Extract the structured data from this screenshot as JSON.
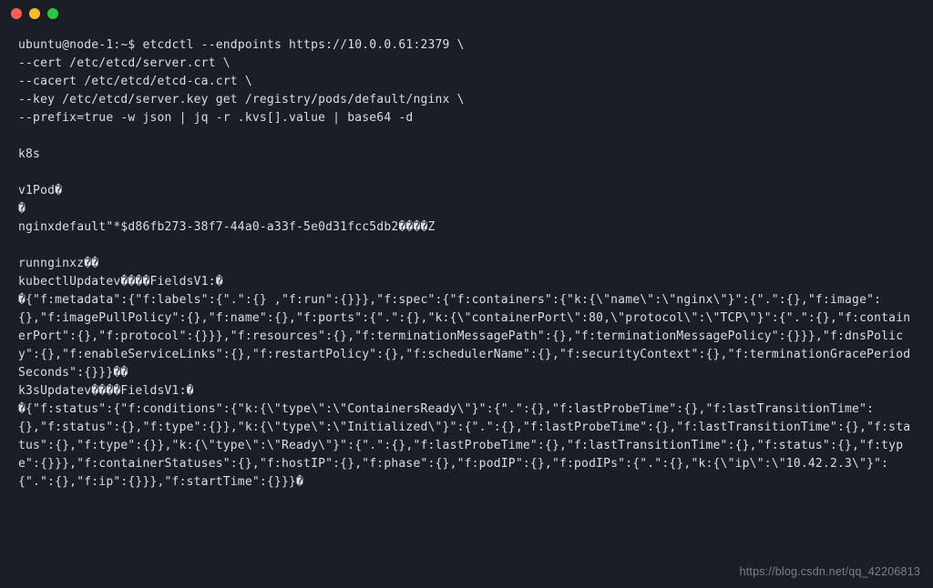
{
  "prompt": "ubuntu@node-1:~$ ",
  "command_lines": [
    "etcdctl --endpoints https://10.0.0.61:2379 \\",
    "--cert /etc/etcd/server.crt \\",
    "--cacert /etc/etcd/etcd-ca.crt \\",
    "--key /etc/etcd/server.key get /registry/pods/default/nginx \\",
    "--prefix=true -w json | jq -r .kvs[].value | base64 -d"
  ],
  "output_lines": [
    "",
    "k8s",
    "",
    "v1Pod�",
    "�",
    "nginxdefault\"*$d86fb273-38f7-44a0-a33f-5e0d31fcc5db2����Z",
    "",
    "runnginxz��",
    "kubectlUpdatev����FieldsV1:�",
    "�{\"f:metadata\":{\"f:labels\":{\".\":{} ,\"f:run\":{}}},\"f:spec\":{\"f:containers\":{\"k:{\\\"name\\\":\\\"nginx\\\"}\":{\".\":{},\"f:image\":{},\"f:imagePullPolicy\":{},\"f:name\":{},\"f:ports\":{\".\":{},\"k:{\\\"containerPort\\\":80,\\\"protocol\\\":\\\"TCP\\\"}\":{\".\":{},\"f:containerPort\":{},\"f:protocol\":{}}},\"f:resources\":{},\"f:terminationMessagePath\":{},\"f:terminationMessagePolicy\":{}}},\"f:dnsPolicy\":{},\"f:enableServiceLinks\":{},\"f:restartPolicy\":{},\"f:schedulerName\":{},\"f:securityContext\":{},\"f:terminationGracePeriodSeconds\":{}}}��",
    "k3sUpdatev����FieldsV1:�",
    "�{\"f:status\":{\"f:conditions\":{\"k:{\\\"type\\\":\\\"ContainersReady\\\"}\":{\".\":{},\"f:lastProbeTime\":{},\"f:lastTransitionTime\":{},\"f:status\":{},\"f:type\":{}},\"k:{\\\"type\\\":\\\"Initialized\\\"}\":{\".\":{},\"f:lastProbeTime\":{},\"f:lastTransitionTime\":{},\"f:status\":{},\"f:type\":{}},\"k:{\\\"type\\\":\\\"Ready\\\"}\":{\".\":{},\"f:lastProbeTime\":{},\"f:lastTransitionTime\":{},\"f:status\":{},\"f:type\":{}}},\"f:containerStatuses\":{},\"f:hostIP\":{},\"f:phase\":{},\"f:podIP\":{},\"f:podIPs\":{\".\":{},\"k:{\\\"ip\\\":\\\"10.42.2.3\\\"}\":{\".\":{},\"f:ip\":{}}},\"f:startTime\":{}}}�"
  ],
  "watermark": "https://blog.csdn.net/qq_42206813"
}
